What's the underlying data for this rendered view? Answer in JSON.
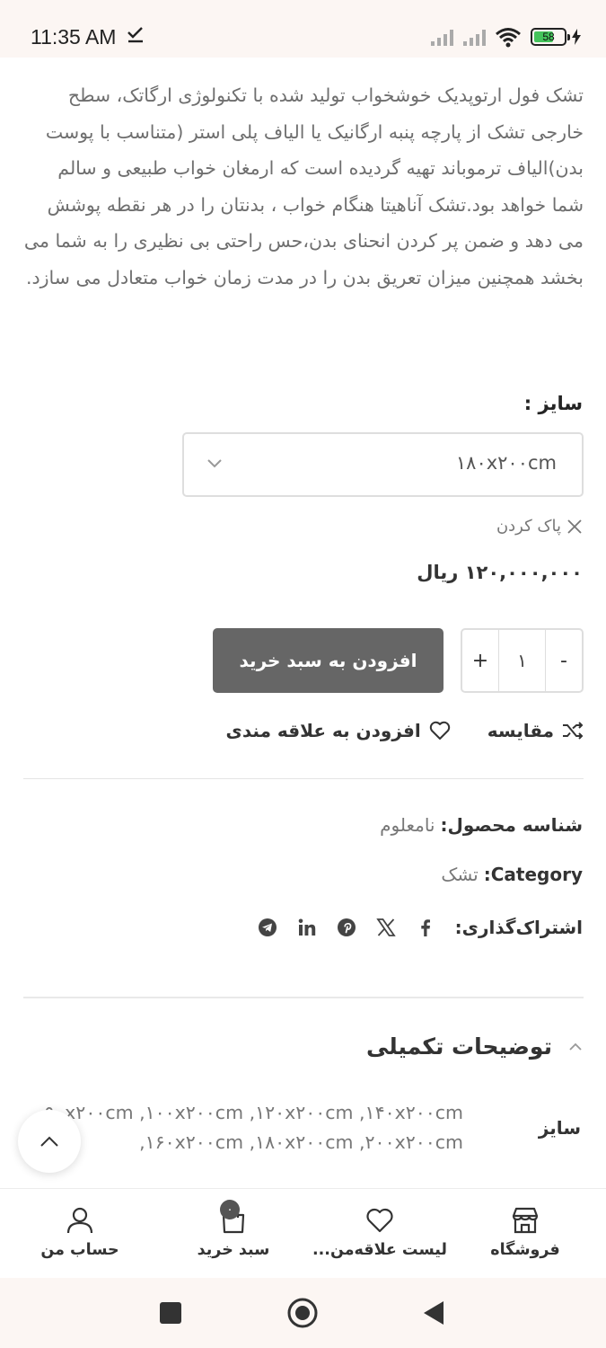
{
  "status": {
    "time": "11:35 AM",
    "battery": "58"
  },
  "product": {
    "description": "تشک فول ارتوپدیک خوشخواب تولید شده با تکنولوژی ارگاتک، سطح خارجی تشک از پارچه پنبه ارگانیک یا الیاف پلی استر (متناسب با پوست بدن)الیاف ترموباند تهیه گردیده است که ارمغان خواب طبیعی و سالم شما خواهد بود.تشک آناهیتا هنگام خواب ، بدنتان را در هر نقطه پوشش می دهد و ضمن پر کردن انحنای بدن،حس راحتی بی نظیری را به شما می بخشد همچنین میزان تعریق بدن را در مدت زمان خواب متعادل می سازد.",
    "size_label": "سایز :",
    "size_selected": "۱۸۰x۲۰۰cm",
    "clear_label": "پاک کردن",
    "price": "۱۲۰,۰۰۰,۰۰۰ ریال",
    "quantity": "۱",
    "minus": "-",
    "plus": "+",
    "add_to_cart": "افزودن به سبد خرید",
    "compare": "مقایسه",
    "add_to_wishlist": "افزودن به علاقه مندی"
  },
  "meta": {
    "sku_key": "شناسه محصول:",
    "sku_value": "نامعلوم",
    "category_key": "Category:",
    "category_value": "تشک",
    "share_key": "اشتراک‌گذاری:",
    "share_icons": [
      "facebook-icon",
      "x-icon",
      "pinterest-icon",
      "linkedin-icon",
      "telegram-icon"
    ]
  },
  "additional": {
    "title": "توضیحات تکمیلی",
    "attr_label": "سایز",
    "attr_value": "۹۰x۲۰۰cm ,۱۰۰x۲۰۰cm ,۱۲۰x۲۰۰cm ,۱۴۰x۲۰۰cm ,۱۶۰x۲۰۰cm ,۱۸۰x۲۰۰cm ,۲۰۰x۲۰۰cm"
  },
  "bottom_nav": {
    "shop": "فروشگاه",
    "wishlist": "لیست علاقه‌من...",
    "cart": "سبد خرید",
    "cart_count": "۰",
    "account": "حساب من"
  },
  "colors": {
    "button_bg": "#666666",
    "status_bg": "#fcf6f3",
    "battery_fill": "#44c35b"
  }
}
